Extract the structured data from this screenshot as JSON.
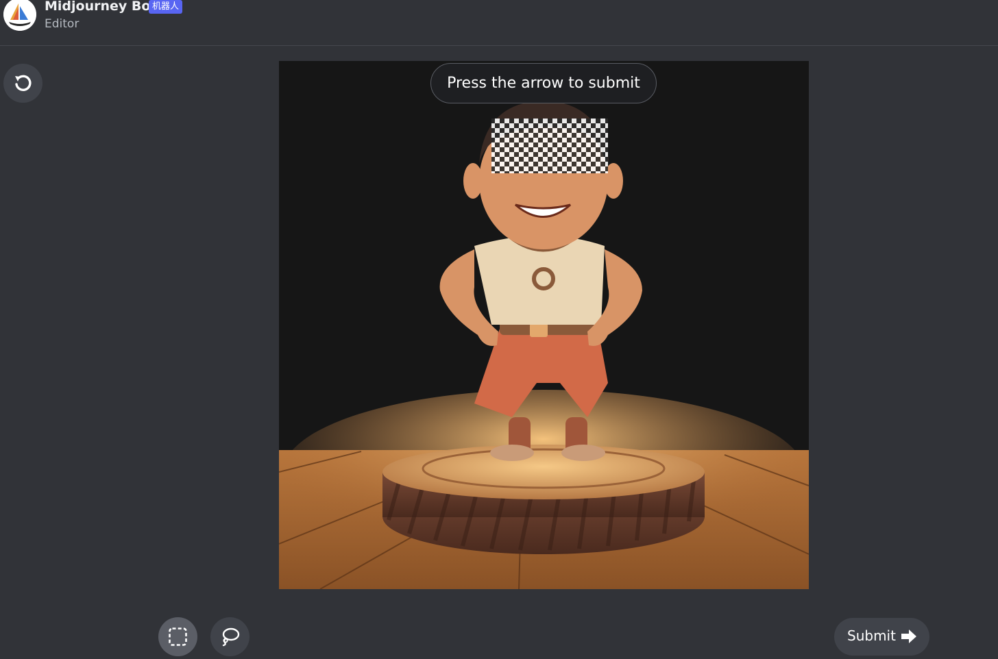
{
  "header": {
    "bot_name": "Midjourney Bot",
    "badge": "机器人",
    "subtitle": "Editor",
    "avatar_icon": "midjourney-sailboat-logo"
  },
  "toolbar": {
    "undo_icon": "undo-icon",
    "rect_select_icon": "rectangle-select-icon",
    "lasso_select_icon": "lasso-icon"
  },
  "canvas": {
    "hint": "Press the arrow to submit",
    "image_subject": "3D cartoon figurine on a pedestal with a masked area over the eyes"
  },
  "submit": {
    "label": "Submit",
    "icon": "arrow-right-icon"
  },
  "colors": {
    "background": "#313338",
    "button": "#40434a",
    "button_active": "#5b5e66",
    "badge": "#5865f2"
  }
}
